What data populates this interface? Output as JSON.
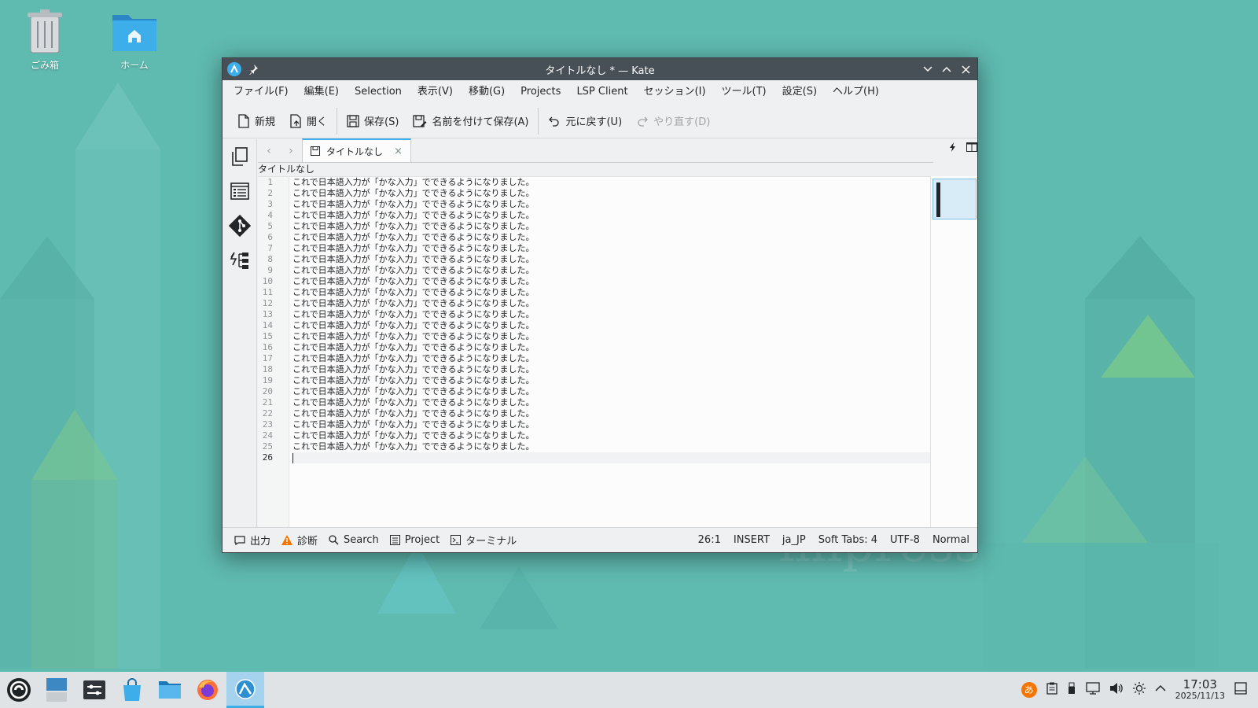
{
  "desktop": {
    "icons": [
      {
        "label": "ごみ箱"
      },
      {
        "label": "ホーム"
      }
    ],
    "watermark": "impress"
  },
  "window": {
    "title": "タイトルなし * — Kate",
    "menu": [
      "ファイル(F)",
      "編集(E)",
      "Selection",
      "表示(V)",
      "移動(G)",
      "Projects",
      "LSP Client",
      "セッション(I)",
      "ツール(T)",
      "設定(S)",
      "ヘルプ(H)"
    ],
    "toolbar": {
      "new": "新規",
      "open": "開く",
      "save": "保存(S)",
      "save_as": "名前を付けて保存(A)",
      "undo": "元に戻す(U)",
      "redo": "やり直す(D)"
    },
    "tab": {
      "label": "タイトルなし"
    },
    "breadcrumb": "タイトルなし",
    "editor": {
      "line_text": "これで日本語入力が「かな入力」でできるようになりました。",
      "line_count": 25,
      "current_line": "26"
    },
    "statusbar": {
      "output": "出力",
      "diagnostics": "診断",
      "search": "Search",
      "project": "Project",
      "terminal": "ターミナル",
      "cursor": "26:1",
      "mode": "INSERT",
      "lang": "ja_JP",
      "tabs": "Soft Tabs: 4",
      "encoding": "UTF-8",
      "highlight": "Normal"
    }
  },
  "taskbar": {
    "time": "17:03",
    "date": "2025/11/13",
    "ime": "あ"
  },
  "colors": {
    "accent": "#3daee9",
    "titlebar": "#475057",
    "desktop": "#5fbab0"
  }
}
